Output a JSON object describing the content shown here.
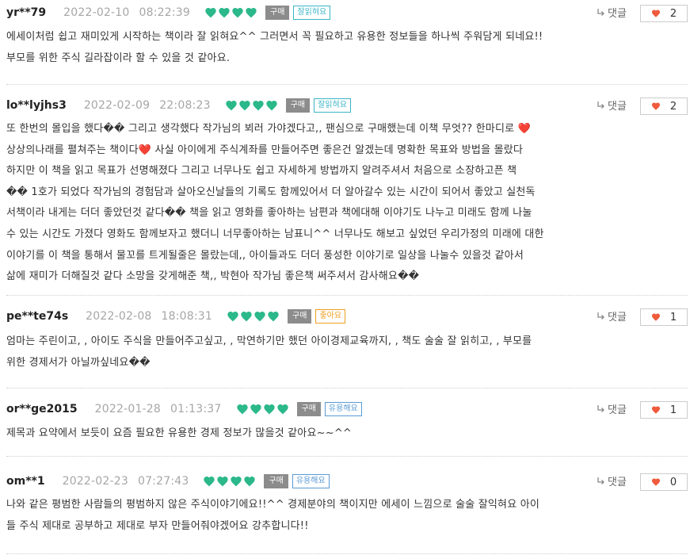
{
  "reviews": [
    {
      "user": "yr**79",
      "date": "2022-02-10",
      "time": "08:22:39",
      "rating": 4,
      "buy_label": "구매",
      "tag_label": "잘읽혀요",
      "tag_color": "#3ab5c6",
      "reply_label": "댓글",
      "likes": "2",
      "lines": [
        "에세이처럼 쉽고 재미있게 시작하는 책이라 잘 읽혀요^^ 그러면서 꼭 필요하고 유용한 정보들을 하나씩 주워담게 되네요!!",
        "부모를 위한 주식 길라잡이라 할 수 있을 것 같아요."
      ]
    },
    {
      "user": "lo**lyjhs3",
      "date": "2022-02-09",
      "time": "22:08:23",
      "rating": 4,
      "buy_label": "구매",
      "tag_label": "잘읽혀요",
      "tag_color": "#3ab5c6",
      "reply_label": "댓글",
      "likes": "2",
      "lines": [
        "또 한번의 몰입을 했다�� 그리고 생각했다 작가님의 뵈러 가야겠다고,, 팬심으로 구매했는데 이책 무엇?? 한마디로 ❤️",
        "상상의나래를 펼쳐주는 책이다❤️ 사실 아이에게 주식계좌를 만들어주면 좋은건 알겠는데 명확한 목표와 방법을 몰랐다",
        "하지만 이 책을 읽고 목표가 선명해졌다 그리고 너무나도 쉽고 자세하게 방법까지 알려주셔서 처음으로 소장하고픈 책",
        "�� 1호가 되었다 작가님의 경험담과 살아오신날들의 기록도 함께있어서 더 알아갈수 있는 시간이 되어서 좋았고 실천독",
        "서책이라 내게는 더더 좋았던것 같다�� 책을 읽고 영화를 좋아하는 남편과 책에대해 이야기도 나누고 미래도 함께 나눌",
        "수 있는 시간도 가졌다 영화도 함께보자고 했더니 너무좋아하는 남표니^^ 너무나도 해보고 싶었던 우리가정의 미래에 대한",
        "이야기를 이 책을 통해서 물꼬를 트게될줄은 몰랐는데,, 아이들과도 더더 풍성한 이야기로 일상을 나눌수 있을것 같아서",
        "삶에 재미가 더해질것 같다 소망을 갖게해준 책,, 박현아 작가님 좋은책 써주셔서 감사해요��"
      ]
    },
    {
      "user": "pe**te74s",
      "date": "2022-02-08",
      "time": "18:08:31",
      "rating": 4,
      "buy_label": "구매",
      "tag_label": "좋아요",
      "tag_color": "#f0a020",
      "reply_label": "댓글",
      "likes": "1",
      "lines": [
        "엄마는 주린이고, , 아이도 주식을 만들어주고싶고, , 막연하기만 했던 아이경제교육까지, , 책도 술술 잘 읽히고, , 부모를",
        "위한 경제서가 아닐까싶네요��"
      ]
    },
    {
      "user": "or**ge2015",
      "date": "2022-01-28",
      "time": "01:13:37",
      "rating": 4,
      "buy_label": "구매",
      "tag_label": "유용해요",
      "tag_color": "#5b9bd5",
      "reply_label": "댓글",
      "likes": "1",
      "lines": [
        "제목과 요약에서 보듯이 요즘 필요한 유용한 경제 정보가 많을것 같아요~~^^"
      ]
    },
    {
      "user": "om**1",
      "date": "2022-02-23",
      "time": "07:27:43",
      "rating": 4,
      "buy_label": "구매",
      "tag_label": "유용해요",
      "tag_color": "#5b9bd5",
      "reply_label": "댓글",
      "likes": "0",
      "lines": [
        "나와 같은 평범한 사람들의 평범하지 않은 주식이야기에요!!^^ 경제분야의 책이지만 에세이 느낌으로 술술 잘익혀요 아이",
        "들 주식 제대로 공부하고 제대로 부자 만들어줘야겠어요 강추합니다!!"
      ]
    }
  ],
  "colors": {
    "heart_green": "#2bb88a",
    "like_heart": "#f05a3c"
  }
}
